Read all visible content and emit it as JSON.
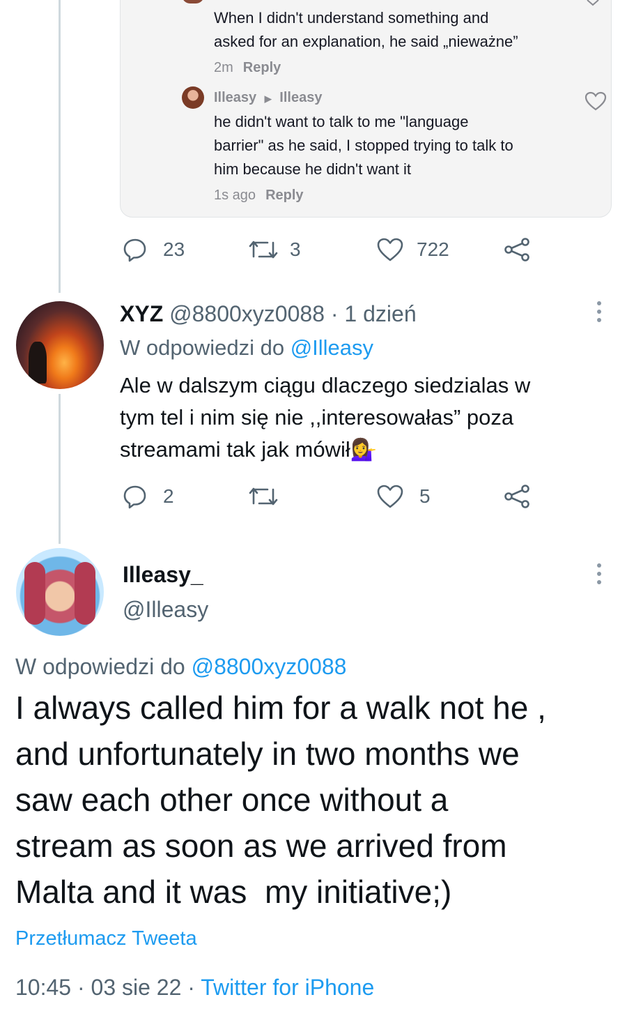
{
  "embedded_comments": {
    "comment1": {
      "text_line1": "When I didn't understand something and",
      "text_line2": "asked for an explanation, he said „nieważne”",
      "time": "2m",
      "reply": "Reply"
    },
    "comment2": {
      "author": "Illeasy",
      "reply_to": "Illeasy",
      "text_line1": "he didn't want to talk to me \"language",
      "text_line2": "barrier\" as he said, I stopped trying to talk to",
      "text_line3": "him because he didn't want it",
      "time": "1s ago",
      "reply": "Reply"
    }
  },
  "tweet1_actions": {
    "replies": "23",
    "retweets": "3",
    "likes": "722"
  },
  "tweet2": {
    "name": "XYZ",
    "handle": "@8800xyz0088",
    "separator": "·",
    "time": "1 dzień",
    "reply_prefix": "W odpowiedzi do",
    "reply_to": "@Illeasy",
    "text_line1": "Ale w dalszym ciągu dlaczego siedzialas w",
    "text_line2": "tym tel i nim się nie ,,interesowałas” poza",
    "text_line3": "streamami tak jak mówił",
    "emoji": "💁‍♀️",
    "actions": {
      "replies": "2",
      "retweets": "",
      "likes": "5"
    }
  },
  "tweet3": {
    "name": "Illeasy_",
    "handle": "@Illeasy",
    "reply_prefix": "W odpowiedzi do",
    "reply_to": "@8800xyz0088",
    "text_line1": "I always called him for a walk not he ,",
    "text_line2": "and unfortunately in two months we",
    "text_line3": "saw each other once without a",
    "text_line4": "stream as soon as we arrived from",
    "text_line5": "Malta and it was  my initiative;)",
    "translate": "Przetłumacz Tweeta",
    "time": "10:45",
    "date": "03 sie 22",
    "separator": "·",
    "client": "Twitter for iPhone"
  },
  "colors": {
    "link": "#1d9bf0",
    "muted": "#536471",
    "thread_line": "#cfd9de"
  },
  "icons": [
    "reply-icon",
    "retweet-icon",
    "like-icon",
    "share-icon",
    "more-icon",
    "heart-outline-icon",
    "triangle-right-icon"
  ]
}
